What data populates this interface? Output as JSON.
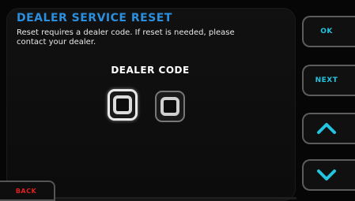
{
  "screen": {
    "title": "DEALER SERVICE RESET",
    "description": "Reset requires a dealer code. If reset is needed, please contact your dealer.",
    "code_label": "DEALER CODE",
    "digits": [
      "0",
      "0"
    ],
    "active_digit": 1
  },
  "side_buttons": {
    "ok_label": "OK",
    "next_label": "NEXT",
    "up_icon": "chevron-up-icon",
    "down_icon": "chevron-down-icon"
  },
  "back_label": "BACK",
  "colors": {
    "title": "#2b8fe0",
    "button_text": "#23c4e0",
    "back_text": "#e02020"
  }
}
